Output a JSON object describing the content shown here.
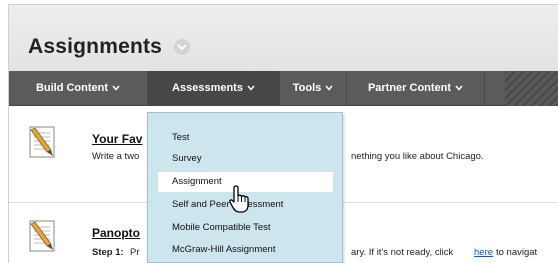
{
  "page": {
    "title": "Assignments"
  },
  "menubar": {
    "items": [
      {
        "label": "Build Content"
      },
      {
        "label": "Assessments"
      },
      {
        "label": "Tools"
      },
      {
        "label": "Partner Content"
      }
    ]
  },
  "content": {
    "item1": {
      "title": "Your Fav",
      "desc_start": "Write a two",
      "desc_end": "nething you like about Chicago."
    },
    "item2": {
      "title": "Panopto",
      "step_label": "Step 1:",
      "step_start": "Pr",
      "step_end": "ary. If it's not ready, click",
      "link": "here",
      "step_tail": "to navigat"
    }
  },
  "dropdown": {
    "items": [
      {
        "label": "Test"
      },
      {
        "label": "Survey"
      },
      {
        "label": "Assignment"
      },
      {
        "label": "Self and Peer Assessment"
      },
      {
        "label": "Mobile Compatible Test"
      },
      {
        "label": "McGraw-Hill Assignment"
      }
    ]
  },
  "icons": {
    "title_chevron": "chevron-down-icon",
    "menu_chevron": "chevron-down-icon",
    "content_item": "document-pencil-icon",
    "pointer": "hand-pointer-icon"
  },
  "colors": {
    "menubar_bg": "#5b5b5b",
    "dropdown_bg": "#cde6ee",
    "link": "#1f4fd8"
  }
}
